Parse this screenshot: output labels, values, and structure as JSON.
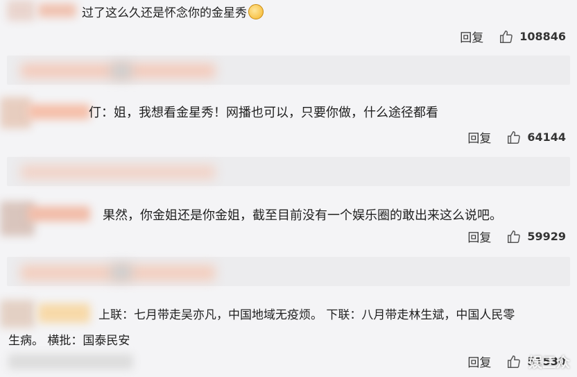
{
  "comments": [
    {
      "text": "过了这么久还是怀念你的金星秀",
      "reply_label": "回复",
      "likes": "108846",
      "emoji_name": "crying-laughing-emoji"
    },
    {
      "text": "仃：姐，我想看金星秀！网播也可以，只要你做，什么途径都看",
      "reply_label": "回复",
      "likes": "64144"
    },
    {
      "text": "果然，你金姐还是你金姐，截至目前没有一个娱乐圈的敢出来这么说吧。",
      "reply_label": "回复",
      "likes": "59929"
    },
    {
      "text_line1": "上联：七月带走吴亦凡，中国地域无疫烦。 下联：八月带走林生斌，中国人民零",
      "text_line2": "生病。 横批：国泰民安",
      "reply_label": "回复",
      "likes": "51530"
    }
  ],
  "watermark": "娱三众",
  "icons": {
    "like": "thumbs-up-icon"
  },
  "colors": {
    "background": "#f4f4f6",
    "subbar": "#ececee",
    "blur_orange": "#f3b49a"
  }
}
